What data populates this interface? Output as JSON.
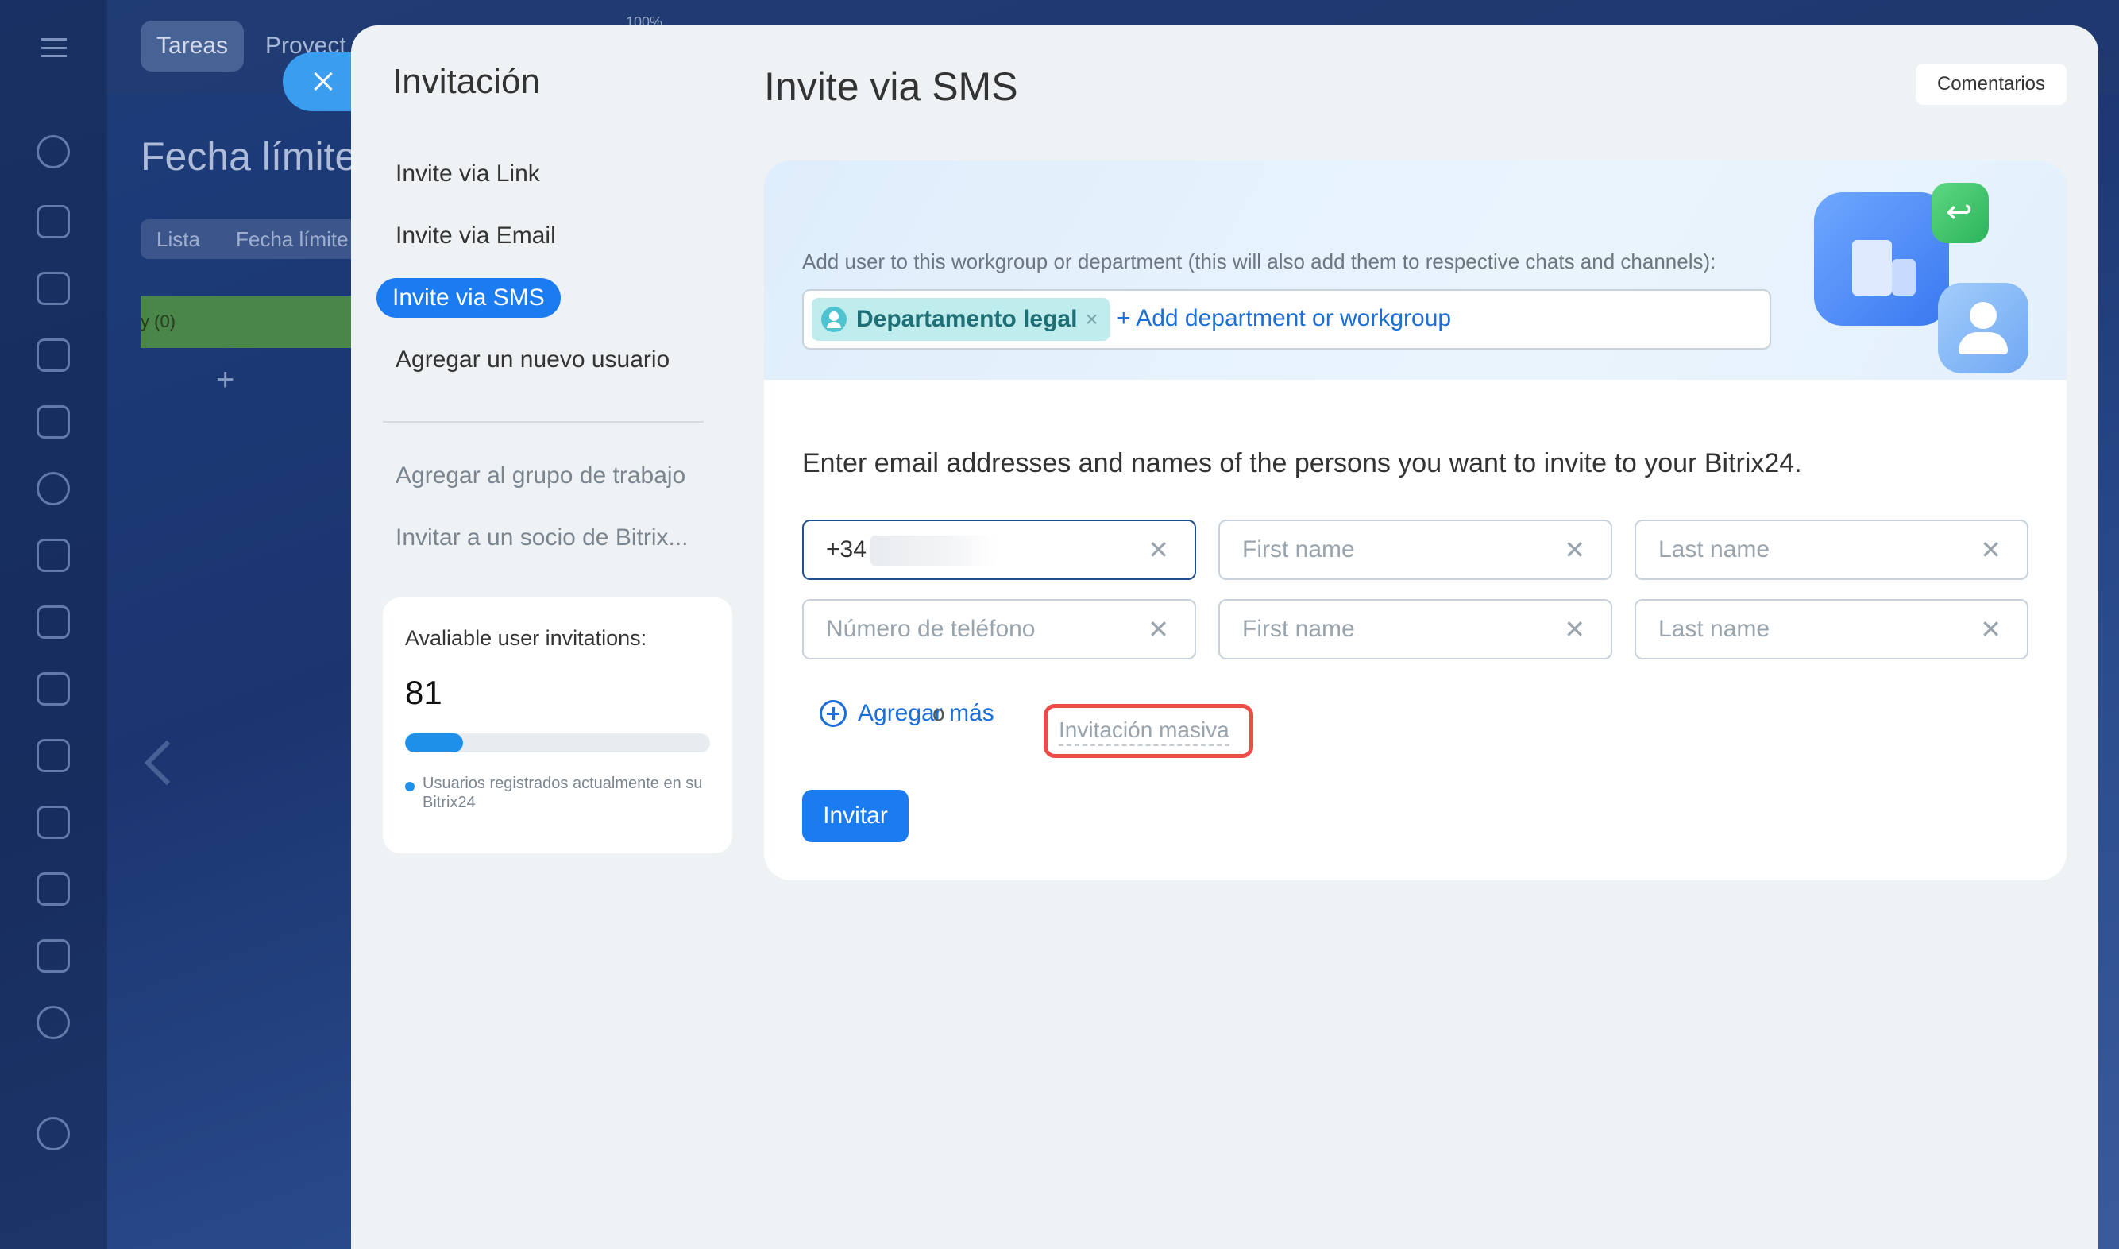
{
  "background": {
    "tabs": [
      "Tareas",
      "Proyect"
    ],
    "title": "Fecha límite",
    "subtabs": [
      "Lista",
      "Fecha límite"
    ],
    "green_label": "y (0)",
    "zoom": "100%"
  },
  "panel": {
    "title": "Invitación",
    "menu": [
      {
        "label": "Invite via Link"
      },
      {
        "label": "Invite via Email"
      },
      {
        "label": "Invite via SMS"
      },
      {
        "label": "Agregar un nuevo usuario"
      },
      {
        "label": "Agregar al grupo de trabajo"
      },
      {
        "label": "Invitar a un socio de Bitrix..."
      }
    ],
    "invitations": {
      "label": "Avaliable user invitations:",
      "count": "81",
      "fill_fraction": 0.19,
      "legend": "Usuarios registrados actualmente en su Bitrix24"
    }
  },
  "content": {
    "title": "Invite via SMS",
    "feedback_label": "Comentarios",
    "department": {
      "description": "Add user to this workgroup or department (this will also add them to respective chats and channels):",
      "chip": "Departamento legal",
      "add_label": "+ Add department or workgroup"
    },
    "form": {
      "heading": "Enter email addresses and names of the persons you want to invite to your Bitrix24.",
      "rows": [
        {
          "phone": "+34",
          "first_name_placeholder": "First name",
          "last_name_placeholder": "Last name"
        },
        {
          "phone_placeholder": "Número de teléfono",
          "first_name_placeholder": "First name",
          "last_name_placeholder": "Last name"
        }
      ],
      "add_more": "Agregar más",
      "or": "o",
      "mass_invite": "Invitación masiva",
      "invite_button": "Invitar"
    }
  },
  "colors": {
    "accent": "#1a7cf0",
    "highlight": "#ef4b47",
    "chip_bg": "#bfecec"
  }
}
